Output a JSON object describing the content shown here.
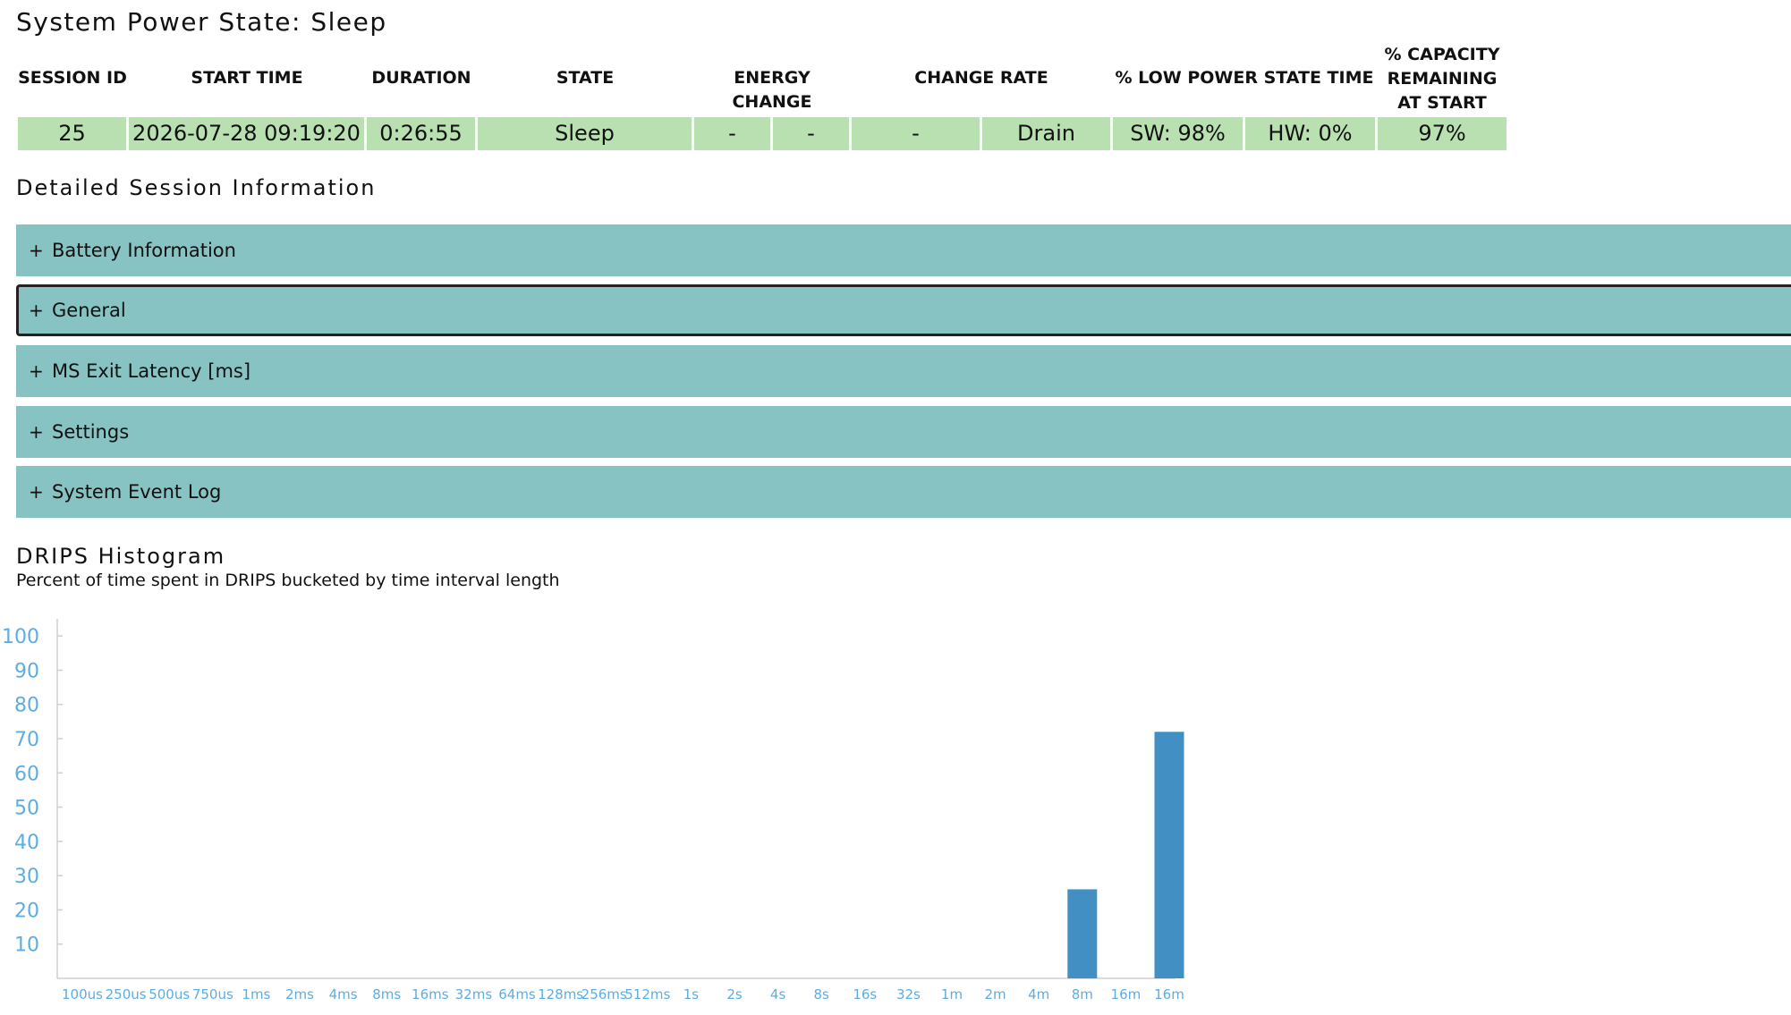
{
  "page": {
    "title": "System Power State: Sleep",
    "detail_heading": "Detailed Session Information",
    "histogram_heading": "DRIPS Histogram",
    "histogram_subtitle": "Percent of time spent in DRIPS bucketed by time interval length"
  },
  "session_table": {
    "headers": {
      "session_id": "SESSION ID",
      "start_time": "START TIME",
      "duration": "DURATION",
      "state": "STATE",
      "energy_change": "ENERGY CHANGE",
      "change_rate": "CHANGE RATE",
      "low_power": "% LOW POWER STATE TIME",
      "capacity_line1": "% CAPACITY",
      "capacity_line2": "REMAINING",
      "capacity_line3": "AT START"
    },
    "row": {
      "session_id": "25",
      "start_time": "2026-07-28   09:19:20",
      "duration": "0:26:55",
      "state": "Sleep",
      "energy_change_1": "-",
      "energy_change_2": "-",
      "change_rate_1": "-",
      "change_rate_2": "Drain",
      "low_power_sw": "SW: 98%",
      "low_power_hw": "HW: 0%",
      "capacity": "97%"
    }
  },
  "sections": [
    {
      "plus": "+",
      "label": "Battery Information"
    },
    {
      "plus": "+",
      "label": "General"
    },
    {
      "plus": "+",
      "label": "MS Exit Latency [ms]"
    },
    {
      "plus": "+",
      "label": "Settings"
    },
    {
      "plus": "+",
      "label": "System Event Log"
    }
  ],
  "colors": {
    "table_cell": "#b8e0b0",
    "section_bar": "#86c3c2",
    "bar": "#428fc3",
    "tick_text": "#5dade2"
  },
  "chart_data": {
    "type": "bar",
    "categories": [
      "100us",
      "250us",
      "500us",
      "750us",
      "1ms",
      "2ms",
      "4ms",
      "8ms",
      "16ms",
      "32ms",
      "64ms",
      "128ms",
      "256ms",
      "512ms",
      "1s",
      "2s",
      "4s",
      "8s",
      "16s",
      "32s",
      "1m",
      "2m",
      "4m",
      "8m",
      "16m",
      "16m"
    ],
    "values": [
      0,
      0,
      0,
      0,
      0,
      0,
      0,
      0,
      0,
      0,
      0,
      0,
      0,
      0,
      0,
      0,
      0,
      0,
      0,
      0,
      0,
      0,
      0,
      26,
      0,
      72
    ],
    "yticks": [
      10,
      20,
      30,
      40,
      50,
      60,
      70,
      80,
      90,
      100
    ],
    "ylim": [
      0,
      105
    ],
    "grid": false
  }
}
